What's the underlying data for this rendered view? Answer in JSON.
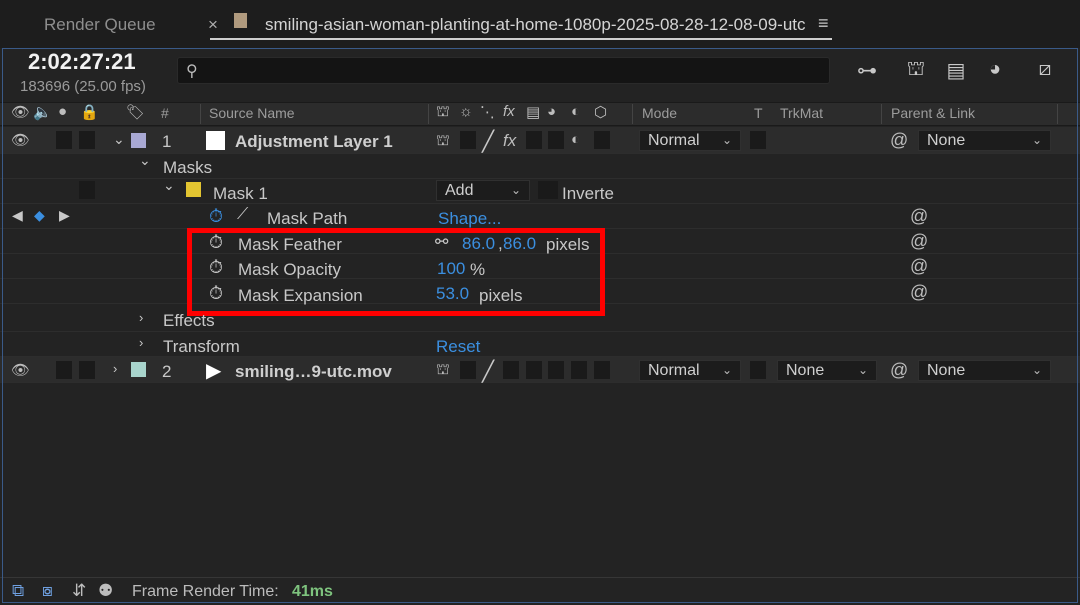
{
  "tabs": {
    "render_queue": "Render Queue",
    "close": "×",
    "comp_name": "smiling-asian-woman-planting-at-home-1080p-2025-08-28-12-08-09-utc",
    "menu": "≡"
  },
  "time": {
    "timecode": "2:02:27:21",
    "frames": "183696 (25.00 fps)"
  },
  "search": {
    "icon": "search-icon",
    "value": ""
  },
  "columns": {
    "hash": "#",
    "source_name": "Source Name",
    "mode": "Mode",
    "t": "T",
    "trkmat": "TrkMat",
    "parent": "Parent & Link"
  },
  "layer1": {
    "index": "1",
    "name": "Adjustment Layer 1",
    "mode": "Normal",
    "parent": "None",
    "label_color": "#a9a9d4"
  },
  "masks": {
    "group_label": "Masks",
    "mask_name": "Mask 1",
    "mask_color": "#e3c531",
    "mode": "Add",
    "inverted_label": "Inverte",
    "path_label": "Mask Path",
    "path_value": "Shape...",
    "feather_label": "Mask Feather",
    "feather_x": "86.0",
    "feather_sep": ",",
    "feather_y": "86.0",
    "feather_unit": "pixels",
    "opacity_label": "Mask Opacity",
    "opacity_value": "100",
    "opacity_unit": "%",
    "expansion_label": "Mask Expansion",
    "expansion_value": "53.0",
    "expansion_unit": "pixels"
  },
  "effects_label": "Effects",
  "transform_label": "Transform",
  "transform_reset": "Reset",
  "layer2": {
    "index": "2",
    "name": "smiling…9-utc.mov",
    "mode": "Normal",
    "trkmat": "None",
    "parent": "None",
    "label_color": "#a8d4cc"
  },
  "footer": {
    "label": "Frame Render Time:",
    "value": "41ms"
  },
  "colors": {
    "accent_blue": "#3b8fe0",
    "highlight_red": "#ff0000",
    "render_time_green": "#7ec37e"
  }
}
